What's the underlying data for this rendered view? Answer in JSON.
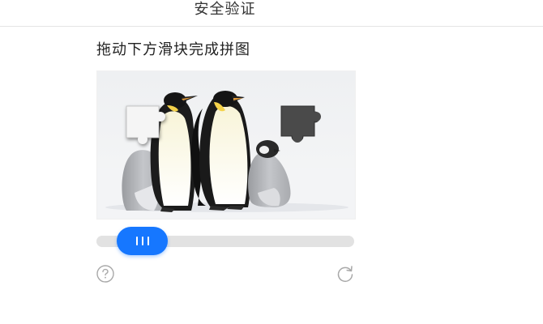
{
  "header": {
    "title": "安全验证"
  },
  "instruction": "拖动下方滑块完成拼图",
  "puzzle": {
    "piece_fill": "#f5f5f5",
    "hole_fill": "#4a4a4a"
  },
  "slider": {
    "progress": 0.08,
    "accent_color": "#1677ff",
    "track_color": "#e2e2e2"
  },
  "icons": {
    "help": "question-circle-icon",
    "refresh": "refresh-icon"
  }
}
